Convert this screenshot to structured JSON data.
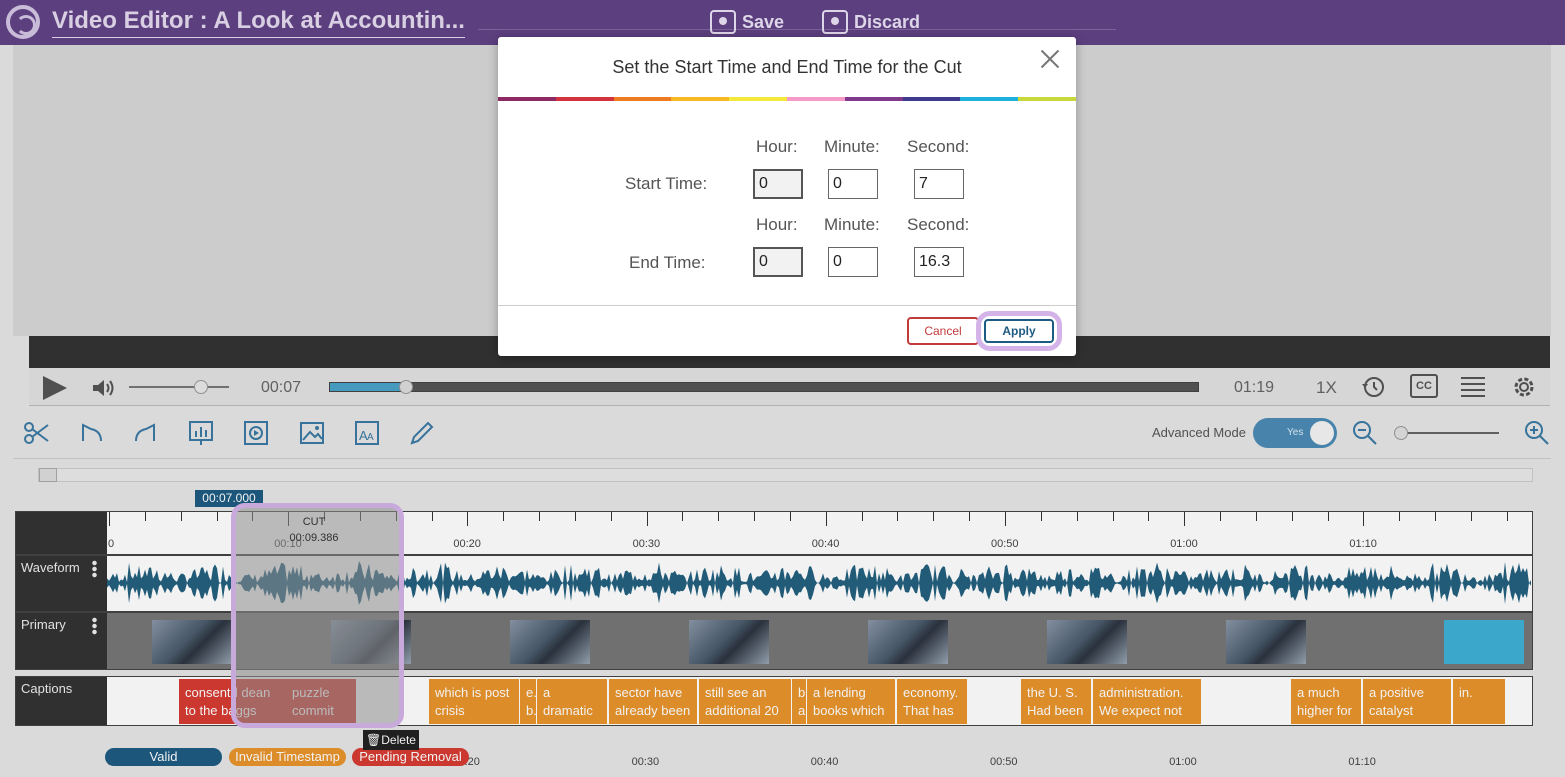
{
  "header": {
    "title": "Video Editor : A Look at Accountin...",
    "save_label": "Save",
    "discard_label": "Discard"
  },
  "player": {
    "current_time": "00:07",
    "total_time": "01:19",
    "speed": "1X",
    "progress_fraction": 0.088,
    "volume_fraction": 0.72
  },
  "toolbar": {
    "advanced_mode_label": "Advanced Mode",
    "toggle_label": "Yes"
  },
  "timeline": {
    "playhead_label": "00:07.000",
    "ruler_ticks": [
      "0",
      "00:10",
      "00:20",
      "00:30",
      "00:40",
      "00:50",
      "01:00",
      "01:10"
    ],
    "tracks": {
      "waveform": "Waveform",
      "primary": "Primary",
      "captions": "Captions"
    },
    "cut_label": "CUT",
    "cut_time": "00:09.386",
    "delete_label": "Delete",
    "captions": [
      {
        "line1": "consent",
        "line2": "to the b",
        "line1b": "d dean",
        "line2b": "aggs"
      },
      {
        "line1": "puzzle",
        "line2": "commit"
      },
      {
        "line1": "which is post",
        "line2": "crisis"
      },
      {
        "line1": "e.",
        "line2": "b."
      },
      {
        "line1": "a",
        "line2": "dramatic"
      },
      {
        "line1": "sector have",
        "line2": "already been"
      },
      {
        "line1": "still see an",
        "line2": "additional 20"
      },
      {
        "line1": "b.",
        "line2": "a."
      },
      {
        "line1": "a lending",
        "line2": "books which"
      },
      {
        "line1": "economy.",
        "line2": "That has"
      },
      {
        "line1": "the U. S.",
        "line2": "Had been"
      },
      {
        "line1": "administration.",
        "line2": "We expect not"
      },
      {
        "line1": "a much",
        "line2": "higher for"
      },
      {
        "line1": "a positive",
        "line2": "catalyst"
      },
      {
        "line1": "in.",
        "line2": ""
      }
    ],
    "legend": {
      "valid": "Valid",
      "invalid": "Invalid Timestamp",
      "pending": "Pending Removal"
    }
  },
  "modal": {
    "title": "Set the Start Time and End Time for the Cut",
    "hour_label": "Hour:",
    "minute_label": "Minute:",
    "second_label": "Second:",
    "start_label": "Start Time:",
    "end_label": "End Time:",
    "start": {
      "hour": "0",
      "minute": "0",
      "second": "7"
    },
    "end": {
      "hour": "0",
      "minute": "0",
      "second": "16.3"
    },
    "cancel_label": "Cancel",
    "apply_label": "Apply"
  },
  "colors": {
    "header_bg": "#5c3f7e",
    "accent_blue": "#1e5b82",
    "caption_orange": "#e8942b",
    "caption_red": "#d63b32",
    "highlight_purple": "#d3b3e8"
  },
  "icons": [
    "logo-icon",
    "save-icon",
    "discard-icon",
    "play-icon",
    "volume-icon",
    "history-icon",
    "cc-icon",
    "list-icon",
    "settings-icon",
    "scissors-icon",
    "undo-icon",
    "redo-icon",
    "chart-icon",
    "video-icon",
    "image-icon",
    "text-icon",
    "pen-icon",
    "zoom-out-icon",
    "zoom-in-icon",
    "close-icon",
    "trash-icon"
  ]
}
